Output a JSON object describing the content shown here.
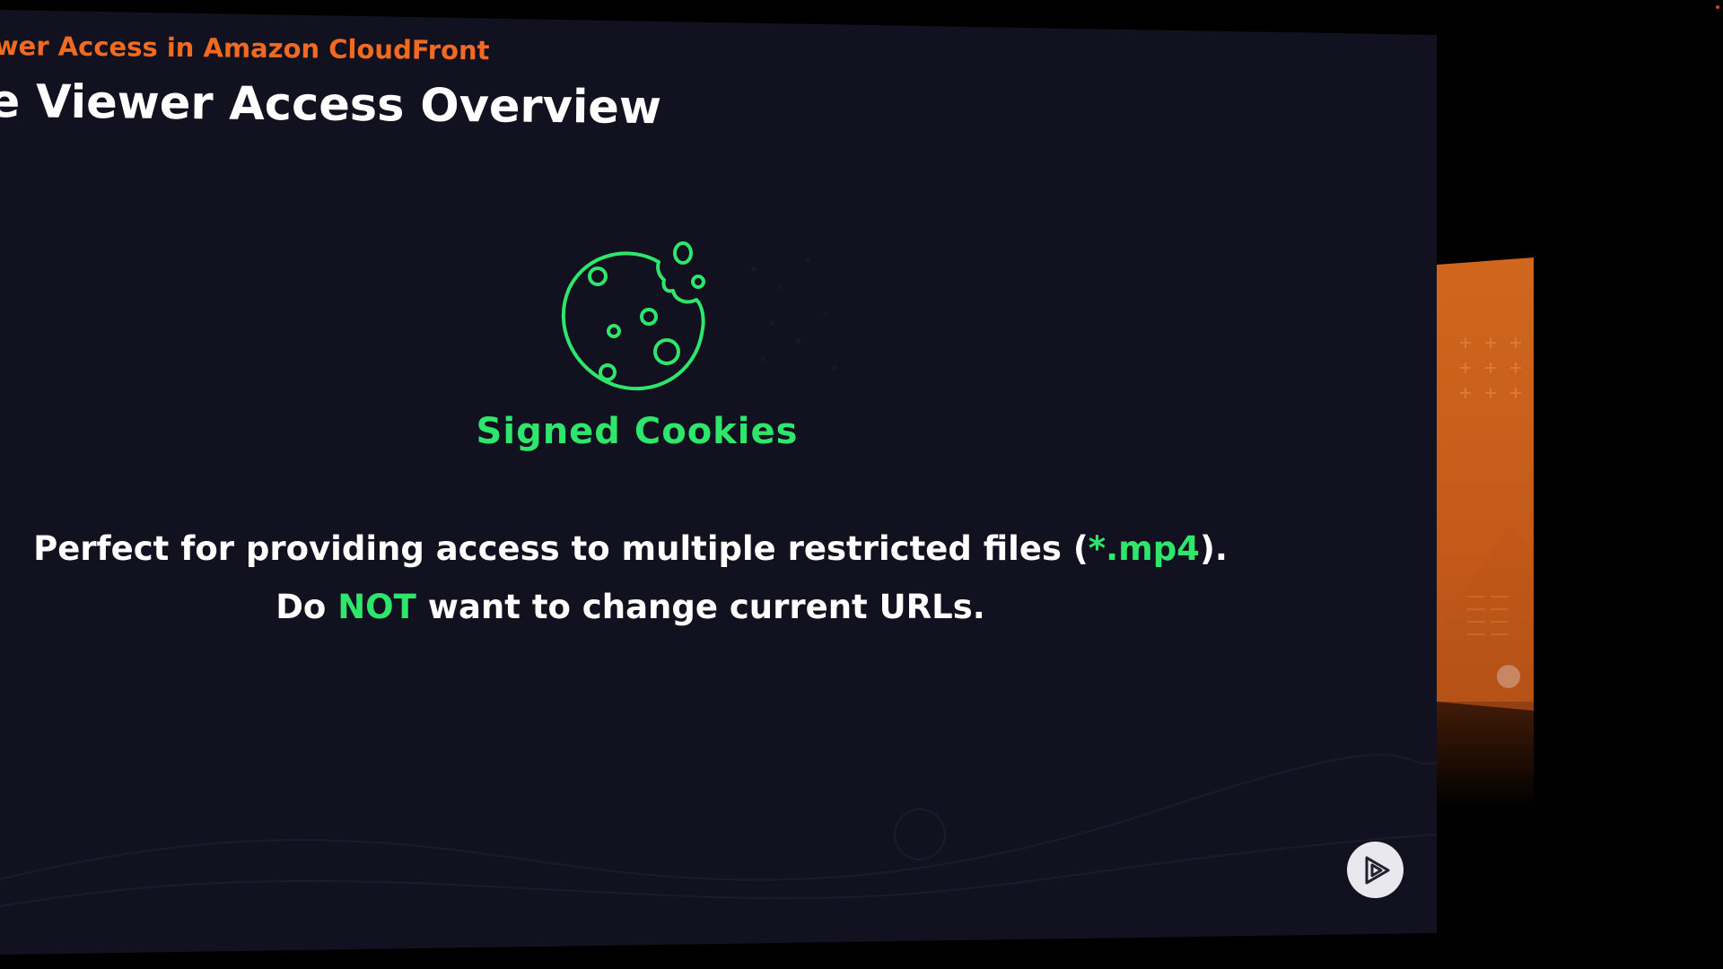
{
  "slide": {
    "course_title": "wer Access in Amazon CloudFront",
    "heading": "e Viewer Access Overview",
    "cookie_label": "Signed Cookies",
    "line1": {
      "before": "Perfect for providing access to multiple restricted files (",
      "highlight": "*.mp4",
      "after": ")."
    },
    "line2": {
      "before": "Do ",
      "highlight": "NOT",
      "after": " want to change current URLs."
    }
  },
  "icons": {
    "cookie": "cookie-icon",
    "logo": "play-logo-icon"
  },
  "colors": {
    "background": "#12111f",
    "accent_orange": "#f06b21",
    "accent_green": "#2ee66b",
    "text": "#ffffff"
  }
}
